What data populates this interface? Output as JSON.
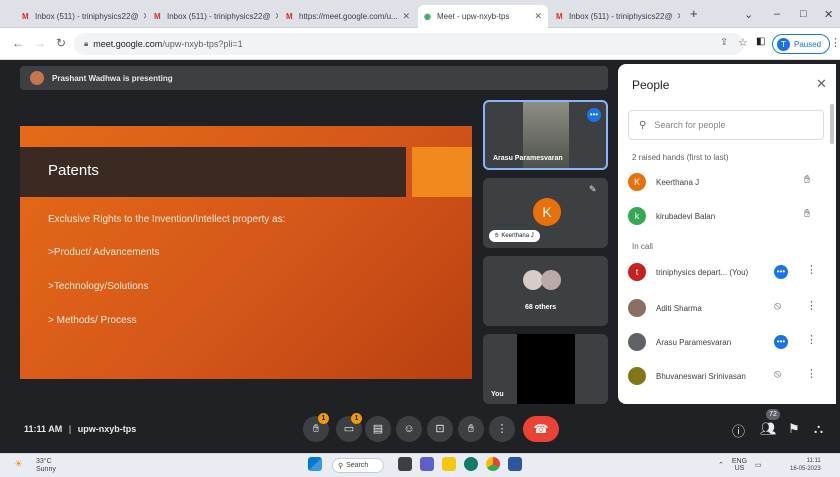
{
  "browser": {
    "tabs": [
      {
        "label": "Inbox (511) - triniphysics22@",
        "active": false
      },
      {
        "label": "Inbox (511) - triniphysics22@",
        "active": false
      },
      {
        "label": "https://meet.google.com/u...",
        "active": false
      },
      {
        "label": "Meet - upw-nxyb-tps",
        "active": true
      },
      {
        "label": "Inbox (511) - triniphysics22@",
        "active": false
      }
    ],
    "url_host": "meet.google.com",
    "url_path": "/upw-nxyb-tps?pli=1",
    "profile_label": "Paused",
    "profile_initial": "T"
  },
  "presenting": {
    "text": "Prashant Wadhwa is presenting"
  },
  "slide": {
    "title": "Patents",
    "lines": [
      "Exclusive Rights to the Invention/Intellect property as:",
      ">Product/ Advancements",
      ">Technology/Solutions",
      "> Methods/ Process"
    ]
  },
  "tiles": {
    "t1_name": "Arasu Paramesvaran",
    "t2_initial": "K",
    "t2_name": "Keerthana J",
    "t3_name": "68 others",
    "t4_name": "You"
  },
  "people": {
    "title": "People",
    "search_placeholder": "Search for people",
    "raised_header": "2 raised hands (first to last)",
    "raised": [
      {
        "initial": "K",
        "name": "Keerthana J",
        "color": "#e8710a"
      },
      {
        "initial": "k",
        "name": "kirubadevi Balan",
        "color": "#34a853"
      }
    ],
    "incall_header": "In call",
    "incall": [
      {
        "initial": "t",
        "name": "triniphysics depart... (You)",
        "color": "#c5221f"
      },
      {
        "initial": "",
        "name": "Aditi Sharma",
        "color": "#8d6e63"
      },
      {
        "initial": "",
        "name": "Arasu Paramesvaran",
        "color": "#5f6368"
      },
      {
        "initial": "",
        "name": "Bhuvaneswari Srinivasan",
        "color": "#827717"
      }
    ]
  },
  "controls": {
    "time": "11:11 AM",
    "separator": "|",
    "meeting_code": "upw-nxyb-tps",
    "hand_badge": "1",
    "captions_badge": "1",
    "people_count": "72"
  },
  "taskbar": {
    "weather_temp": "33°C",
    "weather_desc": "Sunny",
    "search_label": "Search",
    "lang": "ENG",
    "region": "US",
    "time": "11:11",
    "date": "16-05-2023"
  },
  "colors": {
    "slide_orange": "#e56b17",
    "meet_bg": "#202124",
    "end_call": "#ea4335",
    "accent": "#1a73e8"
  }
}
